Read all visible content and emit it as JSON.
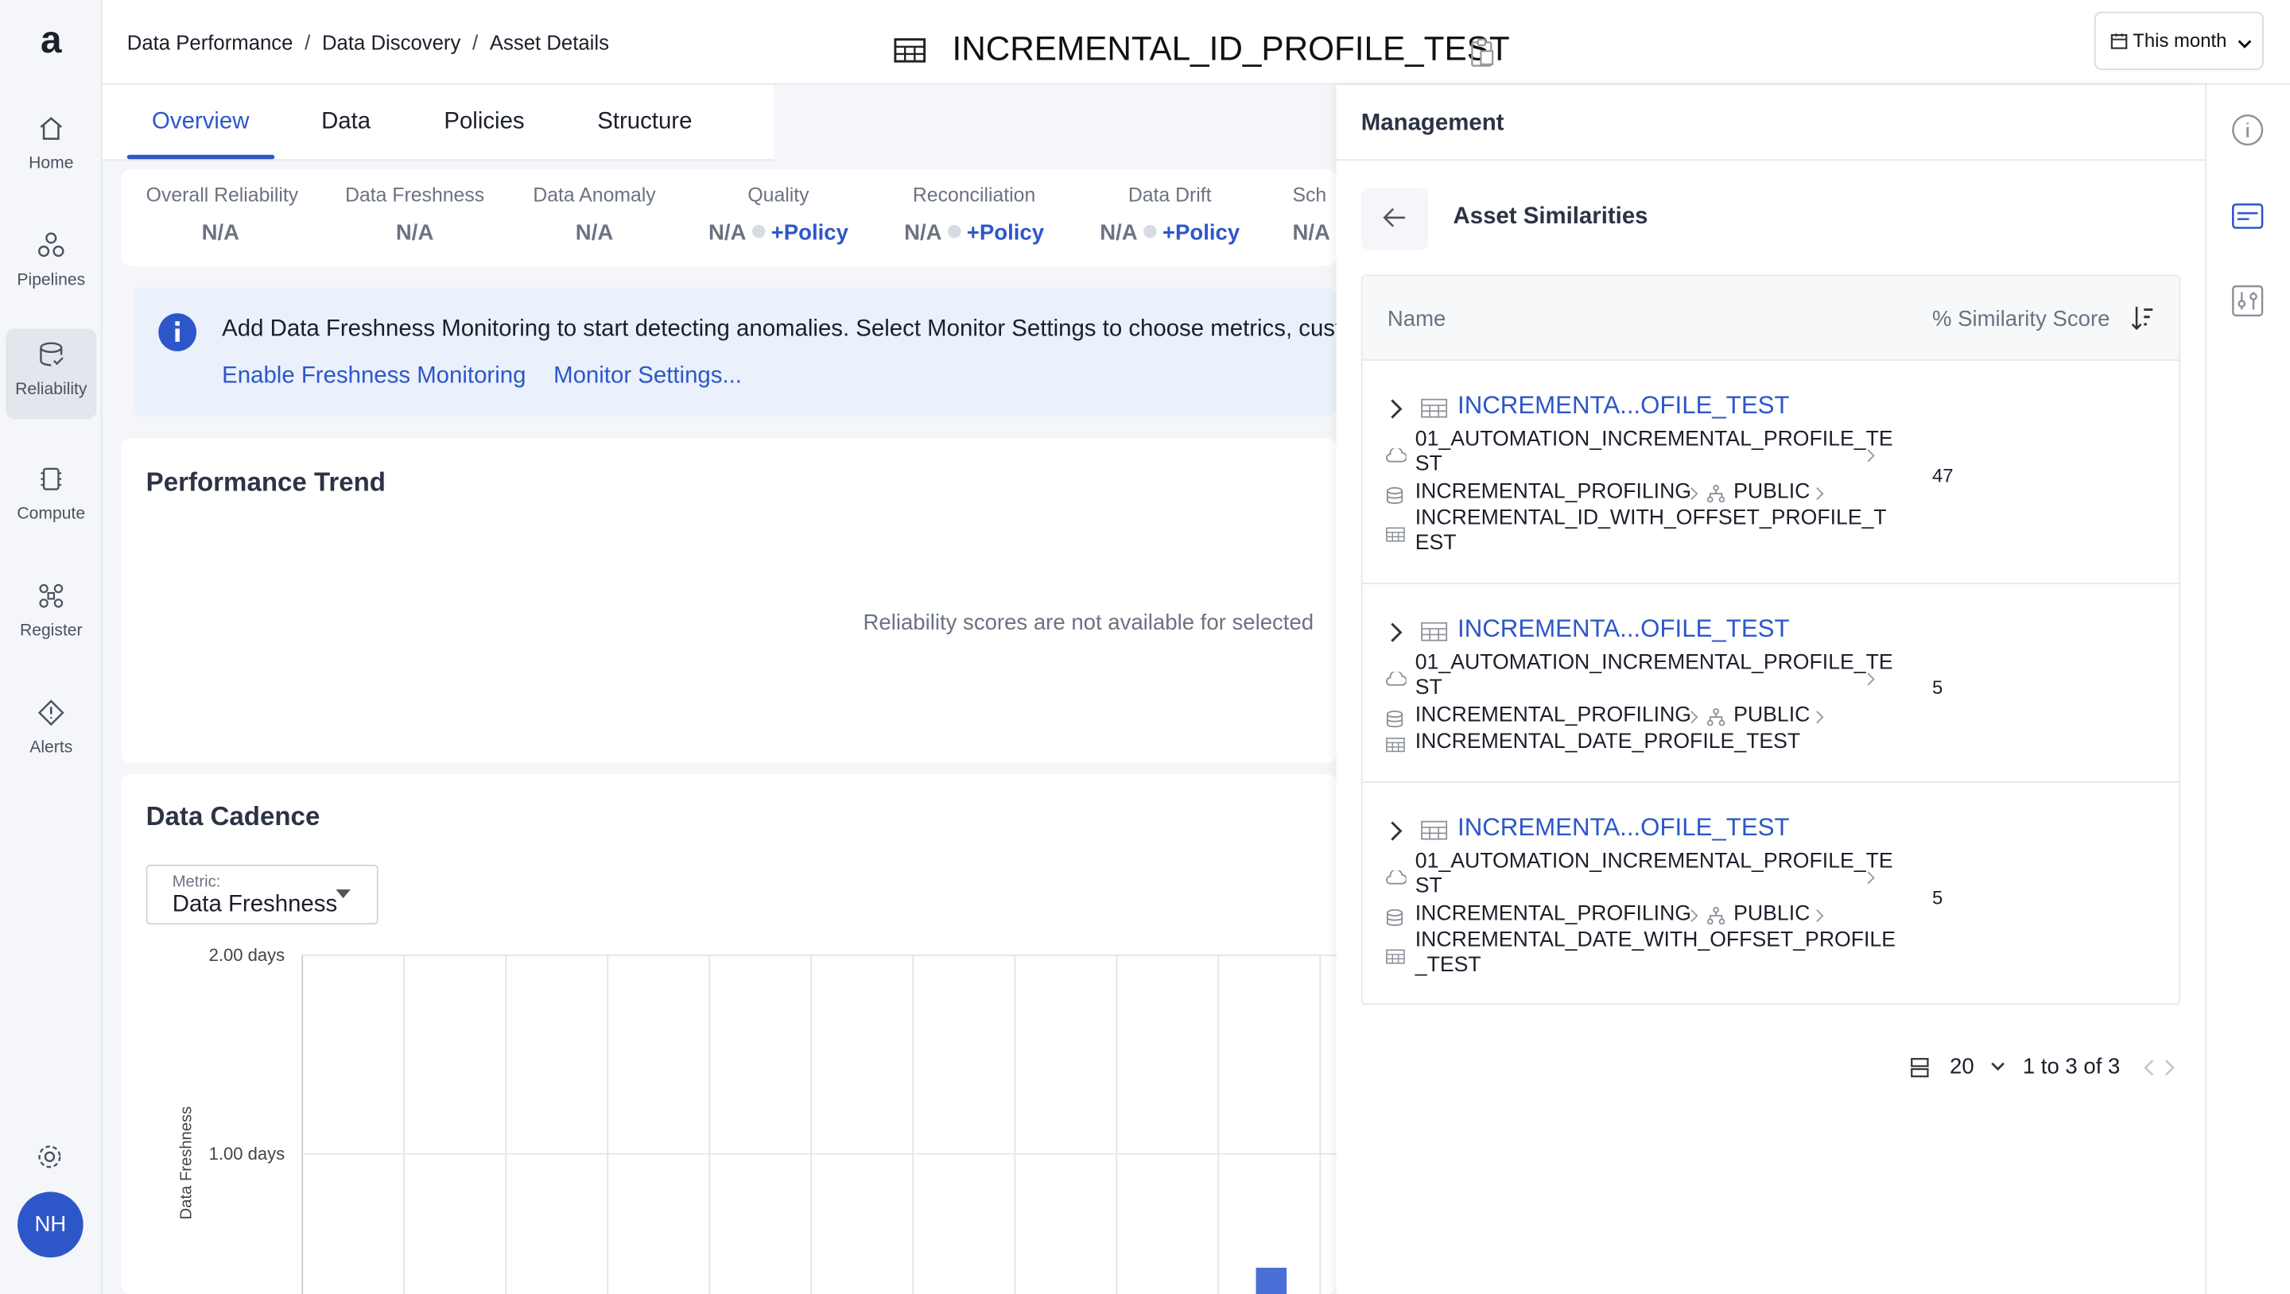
{
  "nav": {
    "logo": "a",
    "items": [
      {
        "label": "Home",
        "icon": "home-icon"
      },
      {
        "label": "Pipelines",
        "icon": "pipelines-icon"
      },
      {
        "label": "Reliability",
        "icon": "reliability-icon",
        "active": true
      },
      {
        "label": "Compute",
        "icon": "compute-icon"
      },
      {
        "label": "Register",
        "icon": "register-icon"
      },
      {
        "label": "Alerts",
        "icon": "alerts-icon"
      }
    ],
    "avatar": "NH"
  },
  "header": {
    "breadcrumbs": [
      "Data Performance",
      "Data Discovery",
      "Asset Details"
    ],
    "separator": "/",
    "title": "INCREMENTAL_ID_PROFILE_TEST",
    "date_filter": "This month"
  },
  "tabs": [
    "Overview",
    "Data",
    "Policies",
    "Structure"
  ],
  "metrics": [
    {
      "label": "Overall Reliability",
      "value": "N/A"
    },
    {
      "label": "Data Freshness",
      "value": "N/A"
    },
    {
      "label": "Data Anomaly",
      "value": "N/A"
    },
    {
      "label": "Quality",
      "value": "N/A",
      "policy": "+Policy"
    },
    {
      "label": "Reconciliation",
      "value": "N/A",
      "policy": "+Policy"
    },
    {
      "label": "Data Drift",
      "value": "N/A",
      "policy": "+Policy"
    },
    {
      "label": "Sch",
      "value": "N/A"
    }
  ],
  "banner": {
    "message": "Add Data Freshness Monitoring to start detecting anomalies. Select Monitor Settings to choose metrics, cust",
    "link_enable": "Enable Freshness Monitoring",
    "link_settings": "Monitor Settings..."
  },
  "performance": {
    "title": "Performance Trend",
    "empty_message": "Reliability scores are not available for selected"
  },
  "cadence": {
    "title": "Data Cadence",
    "metric_label": "Metric:",
    "metric_value": "Data Freshness",
    "chart_data": {
      "type": "bar",
      "ylabel": "Data Freshness",
      "yticks": [
        "2.00 days",
        "1.00 days"
      ],
      "ylim": [
        0,
        2
      ]
    }
  },
  "drawer": {
    "title": "Management",
    "subtitle": "Asset Similarities",
    "col_name": "Name",
    "col_score": "% Similarity Score",
    "rows": [
      {
        "name": "INCREMENTA...OFILE_TEST",
        "source": "01_AUTOMATION_INCREMENTAL_PROFILE_TEST",
        "database": "INCREMENTAL_PROFILING",
        "schema": "PUBLIC",
        "table": "INCREMENTAL_ID_WITH_OFFSET_PROFILE_TEST",
        "score": "47"
      },
      {
        "name": "INCREMENTA...OFILE_TEST",
        "source": "01_AUTOMATION_INCREMENTAL_PROFILE_TEST",
        "database": "INCREMENTAL_PROFILING",
        "schema": "PUBLIC",
        "table": "INCREMENTAL_DATE_PROFILE_TEST",
        "score": "5"
      },
      {
        "name": "INCREMENTA...OFILE_TEST",
        "source": "01_AUTOMATION_INCREMENTAL_PROFILE_TEST",
        "database": "INCREMENTAL_PROFILING",
        "schema": "PUBLIC",
        "table": "INCREMENTAL_DATE_WITH_OFFSET_PROFILE_TEST",
        "score": "5"
      }
    ],
    "page_size": "20",
    "page_info": "1 to 3 of 3"
  },
  "rail": [
    "info-icon",
    "card-icon",
    "sliders-icon"
  ],
  "colors": {
    "accent": "#2d57c9",
    "muted": "#6b7280",
    "banner_bg": "#eaf1fb"
  }
}
